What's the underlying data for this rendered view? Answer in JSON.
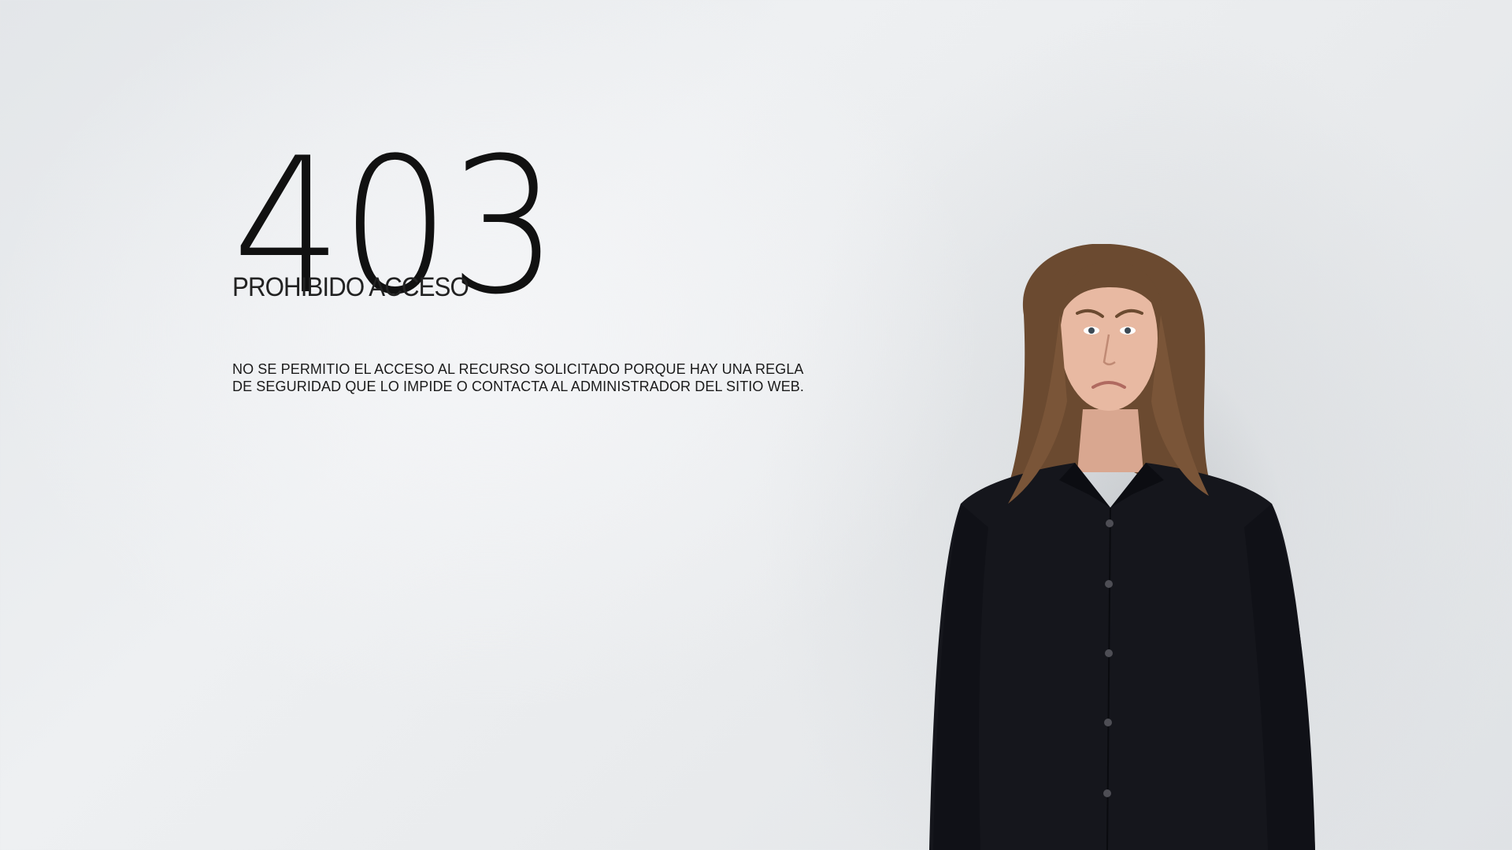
{
  "error": {
    "code": "403",
    "title": "PROHIBIDO ACCESO",
    "message_line1": "NO SE PERMITIO EL ACCESO AL RECURSO SOLICITADO PORQUE HAY UNA REGLA",
    "message_line2": "DE SEGURIDAD QUE LO IMPIDE O CONTACTA AL ADMINISTRADOR DEL SITIO WEB."
  },
  "image": {
    "subject": "sad-woman-photo",
    "shirt_color": "#15161c",
    "hair_color": "#6b4a30",
    "skin_color": "#e8b9a2"
  }
}
